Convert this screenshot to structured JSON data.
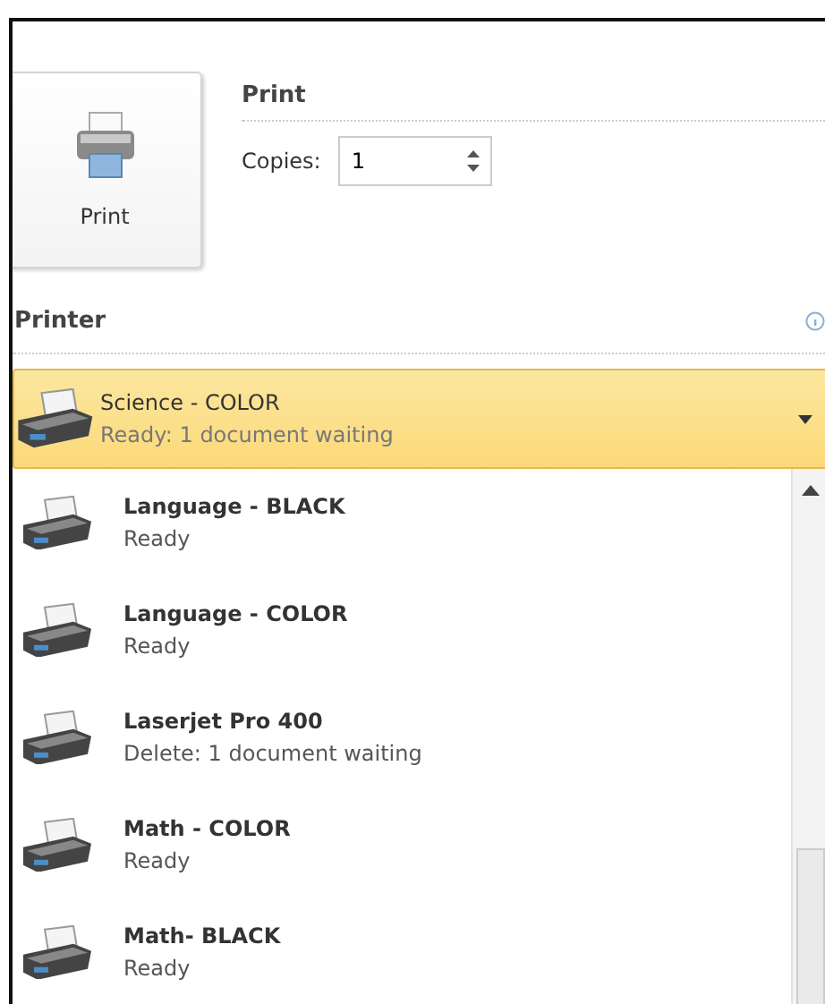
{
  "print_button": {
    "label": "Print"
  },
  "print_section": {
    "title": "Print",
    "copies_label": "Copies:",
    "copies_value": "1"
  },
  "printer_section": {
    "title": "Printer"
  },
  "selected_printer": {
    "name": "Science - COLOR",
    "status": "Ready: 1 document waiting"
  },
  "printers": [
    {
      "name": "Language - BLACK",
      "status": "Ready"
    },
    {
      "name": "Language - COLOR",
      "status": "Ready"
    },
    {
      "name": "Laserjet Pro 400",
      "status": "Delete: 1 document waiting"
    },
    {
      "name": "Math - COLOR",
      "status": "Ready"
    },
    {
      "name": "Math- BLACK",
      "status": "Ready"
    }
  ]
}
